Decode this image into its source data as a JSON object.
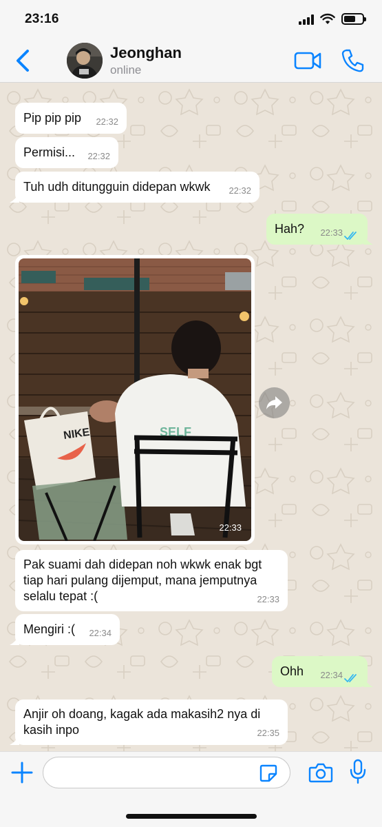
{
  "status_bar": {
    "time": "23:16"
  },
  "header": {
    "contact_name": "Jeonghan",
    "contact_status": "online"
  },
  "messages": [
    {
      "direction": "in",
      "text": "Pip pip pip",
      "time": "22:32"
    },
    {
      "direction": "in",
      "text": "Permisi...",
      "time": "22:32"
    },
    {
      "direction": "in",
      "text": "Tuh udh ditungguin didepan wkwk",
      "time": "22:32"
    },
    {
      "direction": "out",
      "text": "Hah?",
      "time": "22:33",
      "status": "read"
    },
    {
      "direction": "in",
      "type": "photo",
      "time": "22:33",
      "photo_text": {
        "shirt": "SELF",
        "bag": "NIKE"
      }
    },
    {
      "direction": "in",
      "text": "Pak suami dah didepan noh wkwk enak bgt tiap hari pulang dijemput, mana jemputnya selalu tepat :(",
      "time": "22:33"
    },
    {
      "direction": "in",
      "text": "Mengiri :(",
      "time": "22:34"
    },
    {
      "direction": "out",
      "text": "Ohh",
      "time": "22:34",
      "status": "read"
    },
    {
      "direction": "in",
      "text": "Anjir oh doang, kagak ada makasih2 nya di kasih inpo",
      "time": "22:35"
    }
  ],
  "input": {
    "placeholder": "",
    "value": ""
  },
  "colors": {
    "accent": "#0a84ff",
    "outgoing_bubble": "#dcf8c6",
    "incoming_bubble": "#ffffff",
    "chat_background": "#ebe4da",
    "read_ticks": "#34b7f1"
  },
  "icons": [
    "back-chevron-icon",
    "video-camera-icon",
    "phone-icon",
    "forward-icon",
    "plus-icon",
    "sticker-icon",
    "camera-icon",
    "microphone-icon",
    "double-check-icon"
  ]
}
